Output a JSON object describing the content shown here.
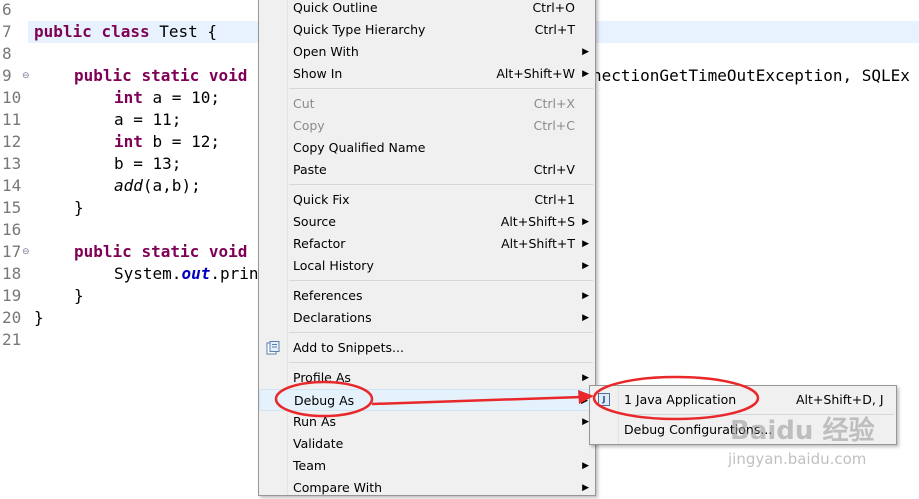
{
  "editor": {
    "line_numbers": [
      "6",
      "7",
      "8",
      "9",
      "10",
      "11",
      "12",
      "13",
      "14",
      "15",
      "16",
      "17",
      "18",
      "19",
      "20",
      "21"
    ],
    "lines": {
      "l7": {
        "kw1": "public",
        "kw2": "class",
        "rest": " Test {"
      },
      "l9": {
        "kw1": "public",
        "kw2": "static",
        "kw3": "void",
        "rest": "nectionGetTimeOutException, SQLEx"
      },
      "l10": {
        "kw": "int",
        "rest": " a = 10;"
      },
      "l11": {
        "text": "a = 11;"
      },
      "l12": {
        "kw": "int",
        "rest": " b = 12;"
      },
      "l13": {
        "text": "b = 13;"
      },
      "l14": {
        "call": "add",
        "rest": "(a,b);"
      },
      "l15": {
        "text": "}"
      },
      "l17": {
        "kw1": "public",
        "kw2": "static",
        "kw3": "void"
      },
      "l18": {
        "pre": "System.",
        "field": "out",
        "post": ".prin"
      },
      "l19": {
        "text": "}"
      },
      "l20": {
        "text": "}"
      }
    }
  },
  "context_menu": {
    "items": [
      {
        "label": "Quick Outline",
        "accel": "Ctrl+O"
      },
      {
        "label": "Quick Type Hierarchy",
        "accel": "Ctrl+T"
      },
      {
        "label": "Open With",
        "submenu": true
      },
      {
        "label": "Show In",
        "accel": "Alt+Shift+W",
        "submenu": true
      },
      {
        "label": "Cut",
        "accel": "Ctrl+X",
        "disabled": true
      },
      {
        "label": "Copy",
        "accel": "Ctrl+C",
        "disabled": true
      },
      {
        "label": "Copy Qualified Name"
      },
      {
        "label": "Paste",
        "accel": "Ctrl+V"
      },
      {
        "label": "Quick Fix",
        "accel": "Ctrl+1"
      },
      {
        "label": "Source",
        "accel": "Alt+Shift+S",
        "submenu": true
      },
      {
        "label": "Refactor",
        "accel": "Alt+Shift+T",
        "submenu": true
      },
      {
        "label": "Local History",
        "submenu": true
      },
      {
        "label": "References",
        "submenu": true
      },
      {
        "label": "Declarations",
        "submenu": true
      },
      {
        "label": "Add to Snippets...",
        "icon": "snippets-icon"
      },
      {
        "label": "Profile As",
        "submenu": true
      },
      {
        "label": "Debug As",
        "submenu": true,
        "active": true
      },
      {
        "label": "Run As",
        "submenu": true
      },
      {
        "label": "Validate"
      },
      {
        "label": "Team",
        "submenu": true
      },
      {
        "label": "Compare With",
        "submenu": true
      }
    ],
    "arrow_glyph": "▶"
  },
  "debug_submenu": {
    "items": [
      {
        "label": "1 Java Application",
        "accel": "Alt+Shift+D, J",
        "icon": "java-application-icon",
        "icon_text": "J"
      },
      {
        "label": "Debug Configurations..."
      }
    ]
  },
  "watermark": {
    "brand": "Baidu 经验",
    "url": "jingyan.baidu.com"
  },
  "colors": {
    "keyword": "#7f0055",
    "static_field": "#0000c0",
    "current_line": "#e8f2fe",
    "menu_bg": "#f0f0f0",
    "annotation_red": "#e8282b"
  }
}
